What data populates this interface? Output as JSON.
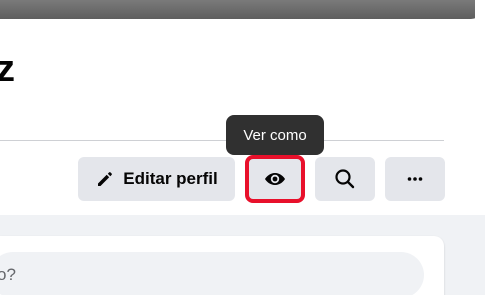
{
  "profile": {
    "name_fragment": "z"
  },
  "tooltip": {
    "text": "Ver como"
  },
  "actions": {
    "edit_profile_label": "Editar perfil",
    "edit_icon": "pencil-icon",
    "view_as_icon": "eye-icon",
    "search_icon": "search-icon",
    "more_icon": "more-dots-icon"
  },
  "composer": {
    "placeholder_fragment": "o?"
  },
  "colors": {
    "button_bg": "#e4e6eb",
    "highlight": "#e8102b",
    "tooltip_bg": "#303030",
    "feed_bg": "#f0f2f5"
  }
}
